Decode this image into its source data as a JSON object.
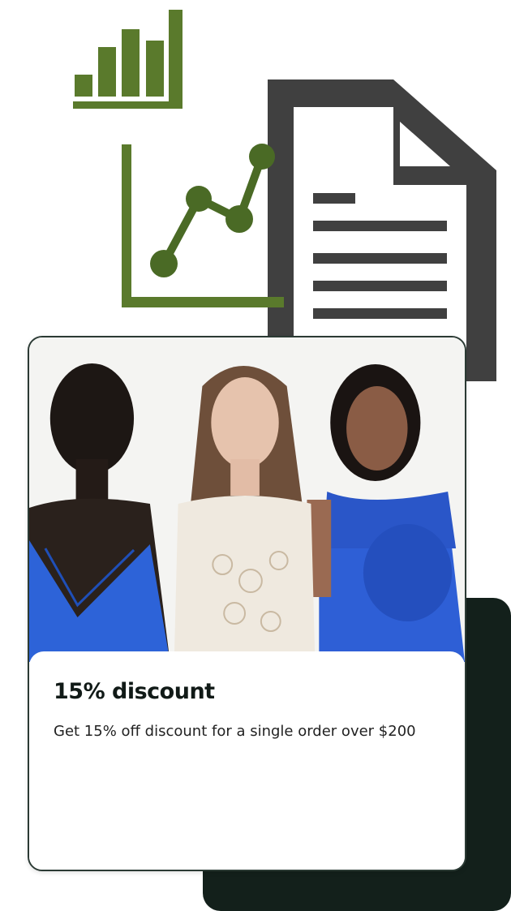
{
  "colors": {
    "accent_green": "#5a7a2c",
    "icon_gray": "#404040",
    "backdrop_dark": "#13201b",
    "top_blue": "#2e5fd6"
  },
  "icons": {
    "bar_chart": "bar-chart-icon",
    "line_chart": "line-chart-icon",
    "document": "document-icon"
  },
  "promo": {
    "title": "15% discount",
    "description": "Get 15% off discount for a single order over $200"
  }
}
